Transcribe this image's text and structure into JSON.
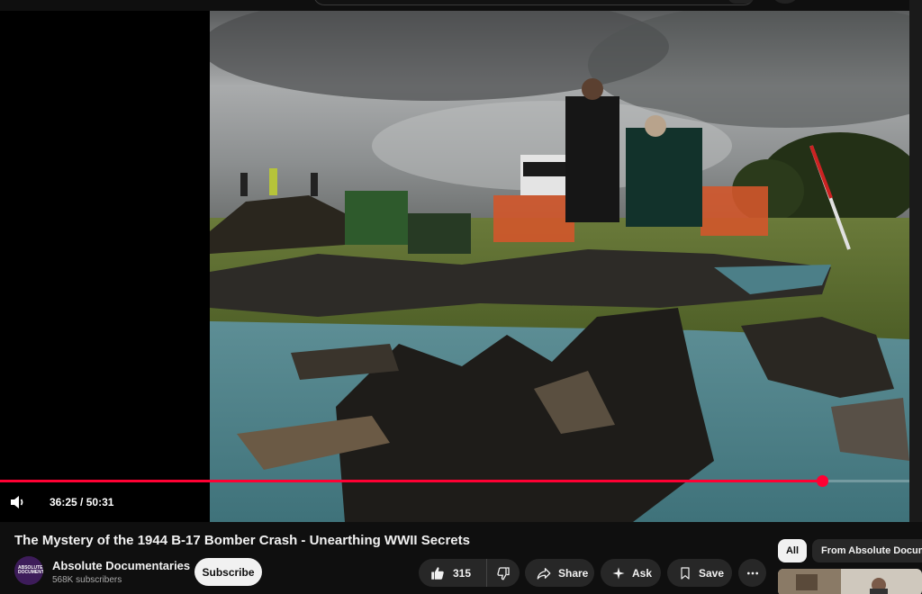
{
  "player": {
    "current_time": "36:25",
    "duration": "50:31",
    "time_separator": "/",
    "progress": 0.904
  },
  "video": {
    "title": "The Mystery of the 1944 B-17 Bomber Crash - Unearthing WWII Secrets"
  },
  "channel": {
    "name": "Absolute Documentaries",
    "subscribers": "568K subscribers",
    "avatar_text": "ABSOLUTE DOCUMENTARIES"
  },
  "actions": {
    "subscribe_label": "Subscribe",
    "like_count": "315",
    "share_label": "Share",
    "ask_label": "Ask",
    "save_label": "Save"
  },
  "sidebar": {
    "chips": [
      "All",
      "From Absolute Docume"
    ]
  },
  "colors": {
    "accent": "#ff0033",
    "background": "#0f0f0f",
    "pill": "#272727"
  }
}
